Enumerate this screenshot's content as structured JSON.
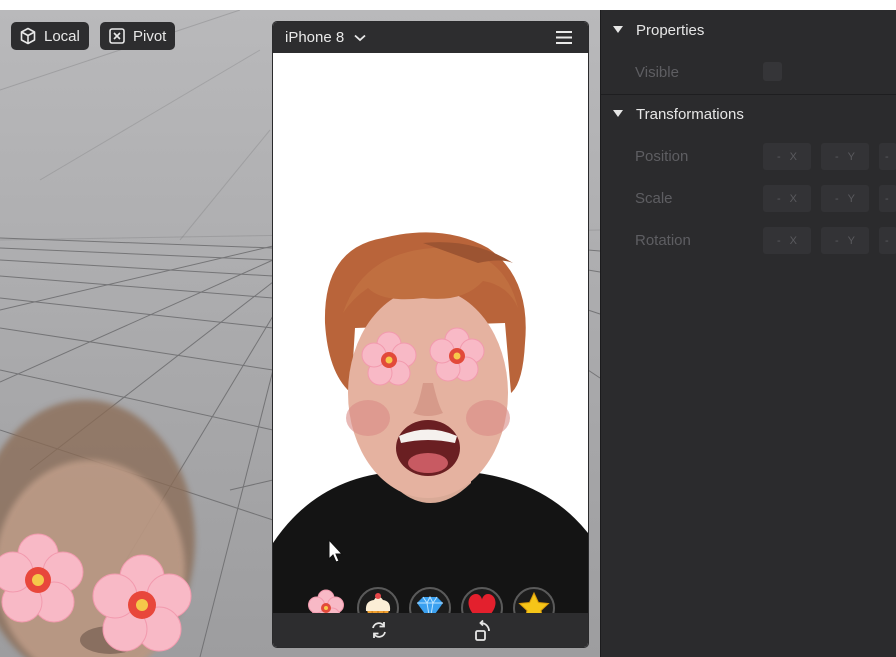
{
  "viewport": {
    "local_button": {
      "label": "Local",
      "icon": "cube-icon"
    },
    "pivot_button": {
      "label": "Pivot",
      "icon": "close-box-icon"
    }
  },
  "simulator": {
    "device": {
      "label": "iPhone 8",
      "icon": "chevron-down-icon"
    },
    "menu_icon": "hamburger-menu-icon",
    "effects": [
      {
        "name": "flower",
        "icon": "cherry-blossom-icon"
      },
      {
        "name": "cupcake",
        "icon": "cupcake-icon"
      },
      {
        "name": "diamond",
        "icon": "diamond-icon"
      },
      {
        "name": "heart",
        "icon": "heart-icon"
      },
      {
        "name": "star",
        "icon": "star-icon"
      }
    ],
    "footer": [
      {
        "name": "refresh",
        "icon": "refresh-icon"
      },
      {
        "name": "rotate",
        "icon": "rotate-device-icon"
      }
    ]
  },
  "panel": {
    "properties": {
      "title": "Properties",
      "visible_label": "Visible"
    },
    "transformations": {
      "title": "Transformations",
      "rows": [
        {
          "label": "Position",
          "fields": [
            "X",
            "Y",
            ""
          ]
        },
        {
          "label": "Scale",
          "fields": [
            "X",
            "Y",
            ""
          ]
        },
        {
          "label": "Rotation",
          "fields": [
            "X",
            "Y",
            ""
          ]
        }
      ],
      "placeholder": "-"
    }
  },
  "colors": {
    "panel_bg": "#2b2b2d",
    "toolbar_bg": "#2d2d2f",
    "viewport_bg": "#b0b0b2",
    "flower_pink": "#f8b7c4",
    "flower_center": "#d8322e",
    "heart": "#e3202d",
    "star": "#f5c518",
    "diamond": "#3aa0f0"
  }
}
